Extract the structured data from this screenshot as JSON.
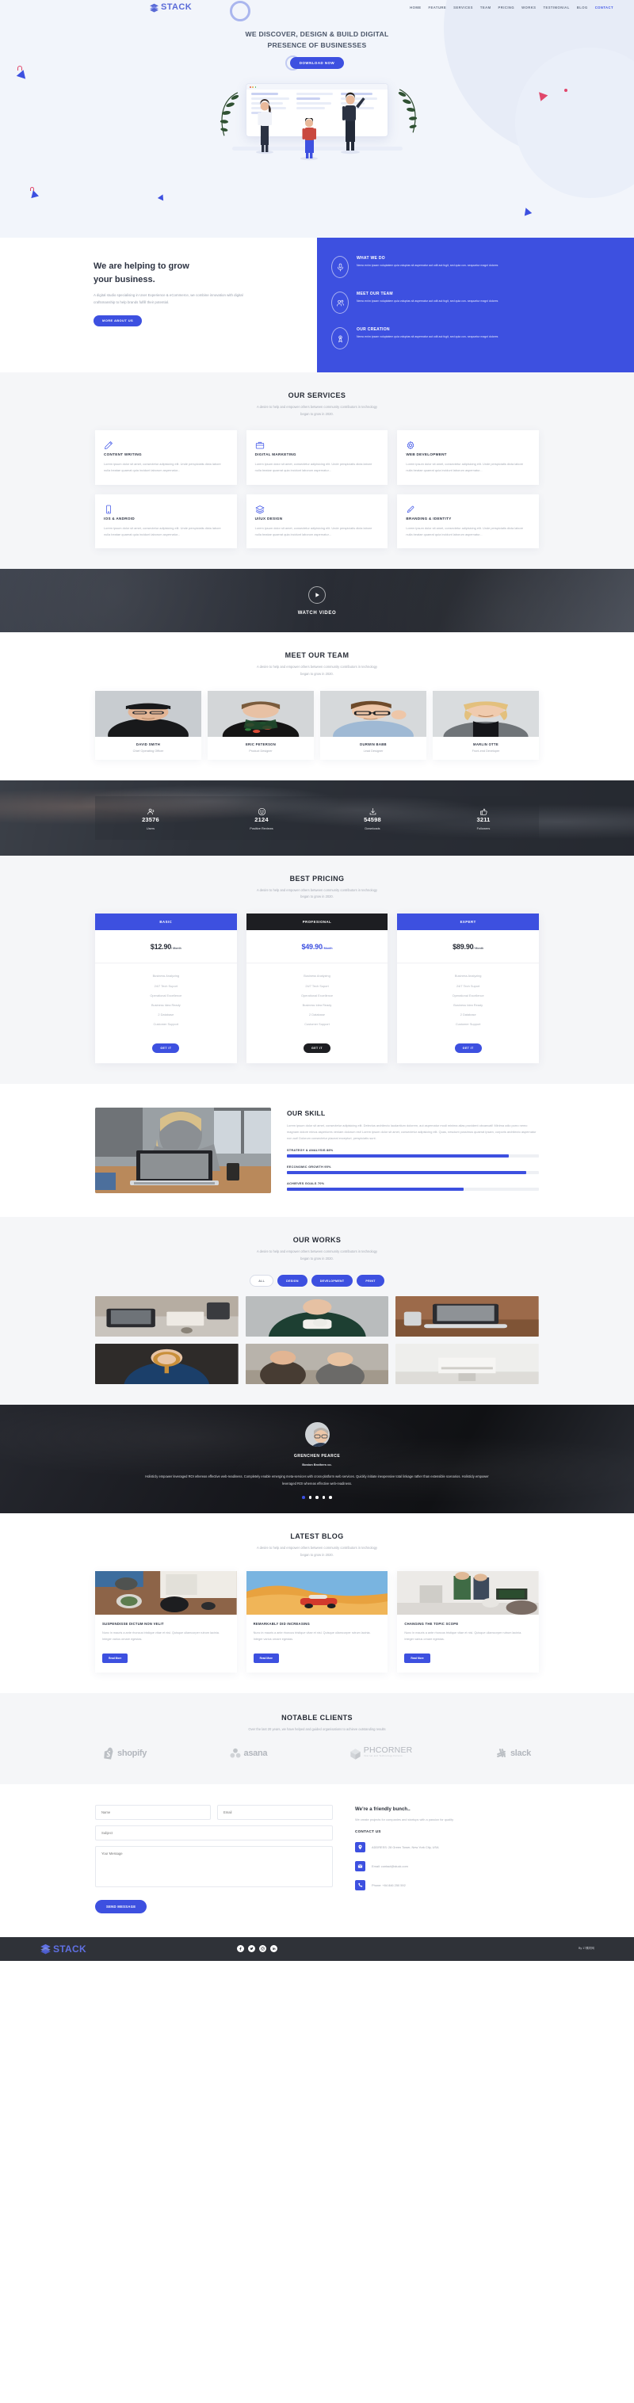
{
  "brand": {
    "name": "STACK"
  },
  "nav": {
    "items": [
      {
        "label": "HOME",
        "active": false
      },
      {
        "label": "FEATURE",
        "active": false
      },
      {
        "label": "SERVICES",
        "active": false
      },
      {
        "label": "TEAM",
        "active": false
      },
      {
        "label": "PRICING",
        "active": false
      },
      {
        "label": "WORKS",
        "active": false
      },
      {
        "label": "TESTIMONIAL",
        "active": false
      },
      {
        "label": "BLOG",
        "active": false
      },
      {
        "label": "CONTACT",
        "active": true
      }
    ]
  },
  "hero": {
    "title_line1": "WE DISCOVER, DESIGN & BUILD DIGITAL",
    "title_line2": "PRESENCE OF BUSINESSES",
    "cta": "DOWNLOAD NOW"
  },
  "grow": {
    "title_line1": "We are helping to grow",
    "title_line2": "your business.",
    "body": "A digital studio specialising in User Experience & eCommerce, we combine innovation with digital craftsmanship to help brands fulfill their potential.",
    "cta": "MORE ABOUT US",
    "features": [
      {
        "icon": "microphone-icon",
        "title": "WHAT WE DO",
        "text": "Nemo enim ipsam voluptatem quia voluptas sit aspernatur aut odit aut fugit, sed quia con- sequuntur magni dolores"
      },
      {
        "icon": "team-icon",
        "title": "MEET OUR TEAM",
        "text": "Nemo enim ipsam voluptatem quia voluptas sit aspernatur aut odit aut fugit, sed quia con- sequuntur magni dolores"
      },
      {
        "icon": "compass-icon",
        "title": "OUR CREATION",
        "text": "Nemo enim ipsam voluptatem quia voluptas sit aspernatur aut odit aut fugit, sed quia con- sequuntur magni dolores"
      }
    ]
  },
  "common_sub": {
    "line1": "A desire to help and empower others between community contributors in technology",
    "line2": "began to grow in 2020."
  },
  "services": {
    "title": "OUR SERVICES",
    "body": "Lorem ipsum dolor sit amet, consectetur adipisicing elit. Unde perspiciatis dicta labore nulla beatae quaerat quia incidunt laborum aspernatur...",
    "items": [
      {
        "icon": "pencil-icon",
        "title": "CONTENT WRITING"
      },
      {
        "icon": "briefcase-icon",
        "title": "DIGITAL MARKETING"
      },
      {
        "icon": "gear-icon",
        "title": "WEB DEVELOPMENT"
      },
      {
        "icon": "mobile-icon",
        "title": "IOS & ANDROID"
      },
      {
        "icon": "layers-icon",
        "title": "UI/UX DESIGN"
      },
      {
        "icon": "rocket-icon",
        "title": "BRANDING & IDENTITY"
      }
    ]
  },
  "video": {
    "title": "WATCH VIDEO",
    "icon": "play-icon"
  },
  "team": {
    "title": "MEET OUR TEAM",
    "members": [
      {
        "name": "DAVID SMITH",
        "role": "Chief Operating Officer"
      },
      {
        "name": "ERIC PETERSON",
        "role": "Product Designer"
      },
      {
        "name": "DURWIN BABB",
        "role": "Lead Designer"
      },
      {
        "name": "MARLIN OTTE",
        "role": "Front-end Developer"
      }
    ]
  },
  "counters": [
    {
      "icon": "users-icon",
      "value": "23576",
      "label": "Users"
    },
    {
      "icon": "smile-icon",
      "value": "2124",
      "label": "Positive Reviews"
    },
    {
      "icon": "download-icon",
      "value": "54598",
      "label": "Downloads"
    },
    {
      "icon": "thumbs-up-icon",
      "value": "3211",
      "label": "Followers"
    }
  ],
  "pricing": {
    "title": "BEST PRICING",
    "plans": [
      {
        "name": "BASIC",
        "price": "$12.90",
        "period": "/ Month",
        "cta": "GET IT",
        "style": "blue"
      },
      {
        "name": "PROFESIONAL",
        "price": "$49.90",
        "period": "/ Month",
        "cta": "GET IT",
        "style": "dark"
      },
      {
        "name": "EXPERT",
        "price": "$89.90",
        "period": "/ Month",
        "cta": "GET IT",
        "style": "blue"
      }
    ],
    "features": [
      "Business Analyzing",
      "24/7 Tech Suport",
      "Operational Excellence",
      "Business Idea Ready",
      "2 Database",
      "Customer Support"
    ]
  },
  "skill": {
    "title": "OUR SKILL",
    "body": "Lorem ipsum dolor sit amet, consectetur adipisicing elit. Delectus architecto laudantium dolorem, aut aspernatur modi minima alias provident obcaecati! Minima odio porro nemo magnam dolore minus asperiores veniam dolorum est! Lorem ipsum dolor sit amet, consectetur adipisicing elit. Quas, nesciunt possimus quaerat ipsam, corporis architecto aspernatur non aut! Dolorum consectetur placeat excepturi, perspiciatis sunt.",
    "bars": [
      {
        "label": "STRATEGY & ANALYSIS 88%",
        "value": 88
      },
      {
        "label": "EECONOMIC GROWTH 95%",
        "value": 95
      },
      {
        "label": "ACHIEVES GOALS 70%",
        "value": 70
      }
    ]
  },
  "works": {
    "title": "OUR WORKS",
    "filters": [
      {
        "label": "ALL",
        "active": false
      },
      {
        "label": "DESIGN",
        "active": true
      },
      {
        "label": "DEVELOPMENT",
        "active": true
      },
      {
        "label": "PRINT",
        "active": true
      }
    ]
  },
  "testimonial": {
    "name": "GRENCHEN PEARCE",
    "company": "Boston Brothers co.",
    "quote": "Holisticly empower leveraged ROI whereas effective web-readiness. Completely enable emerging meta-services with cross-platform web services. Quickly initiate inexpensive total linkage rather than extensible scenarios. Holisticly empower leveraged ROI whereas effective web-readiness.",
    "dots": 5,
    "active_dot": 0
  },
  "blog": {
    "title": "LATEST BLOG",
    "posts": [
      {
        "title": "SUSPENDISSE DICTUM NON VELIT",
        "excerpt": "Nunc in mauris a ante rhoncus tristique vitae et nisl. Quisque ullamcorper rutrum lacinia. Integer varius ornare egestas.",
        "cta": "Read More"
      },
      {
        "title": "REMARKABLY DID INCREASING",
        "excerpt": "Nunc in mauris a ante rhoncus tristique vitae et nisl. Quisque ullamcorper rutrum lacinia. Integer varius ornare egestas.",
        "cta": "Read More"
      },
      {
        "title": "CHANGING THE TOPIC SCOPE",
        "excerpt": "Nunc in mauris a ante rhoncus tristique vitae et nisl. Quisque ullamcorper rutrum lacinia. Integer varius ornare egestas.",
        "cta": "Read More"
      }
    ]
  },
  "clients": {
    "title": "NOTABLE CLIENTS",
    "subtitle": "Over the last 20 years, we have helped and guided organisations to achieve outstanding results",
    "logos": [
      {
        "name": "shopify",
        "label": "shopify"
      },
      {
        "name": "asana",
        "label": "asana"
      },
      {
        "name": "phcorner",
        "label": "PHCORNER",
        "sub": "Internet and Technology Forums"
      },
      {
        "name": "slack",
        "label": "slack"
      }
    ]
  },
  "contact": {
    "fields": {
      "name_placeholder": "Name",
      "email_placeholder": "Email",
      "subject_placeholder": "Subject",
      "message_placeholder": "Your Message"
    },
    "send_label": "SEND MESSAGE",
    "heading": "We're a friendly bunch..",
    "sub": "We create projects for companies and startups with a passion for quality",
    "contact_us": "CONTACT US",
    "lines": [
      {
        "icon": "location-icon",
        "text": "ADDRESS: 28 Green Tower, New York City, USA"
      },
      {
        "icon": "mail-icon",
        "text": "Email: contact@stuck.com"
      },
      {
        "icon": "phone-icon",
        "text": "Phone: +84 846 250 592"
      }
    ]
  },
  "footer": {
    "brand": "STACK",
    "socials": [
      "facebook-icon",
      "twitter-icon",
      "instagram-icon",
      "linkedin-icon"
    ],
    "by": "By 17素材网"
  },
  "colors": {
    "accent": "#3d50e0",
    "dark": "#2f3238",
    "grey_bg": "#f5f6f8",
    "hero_bg": "#f2f5fb"
  }
}
